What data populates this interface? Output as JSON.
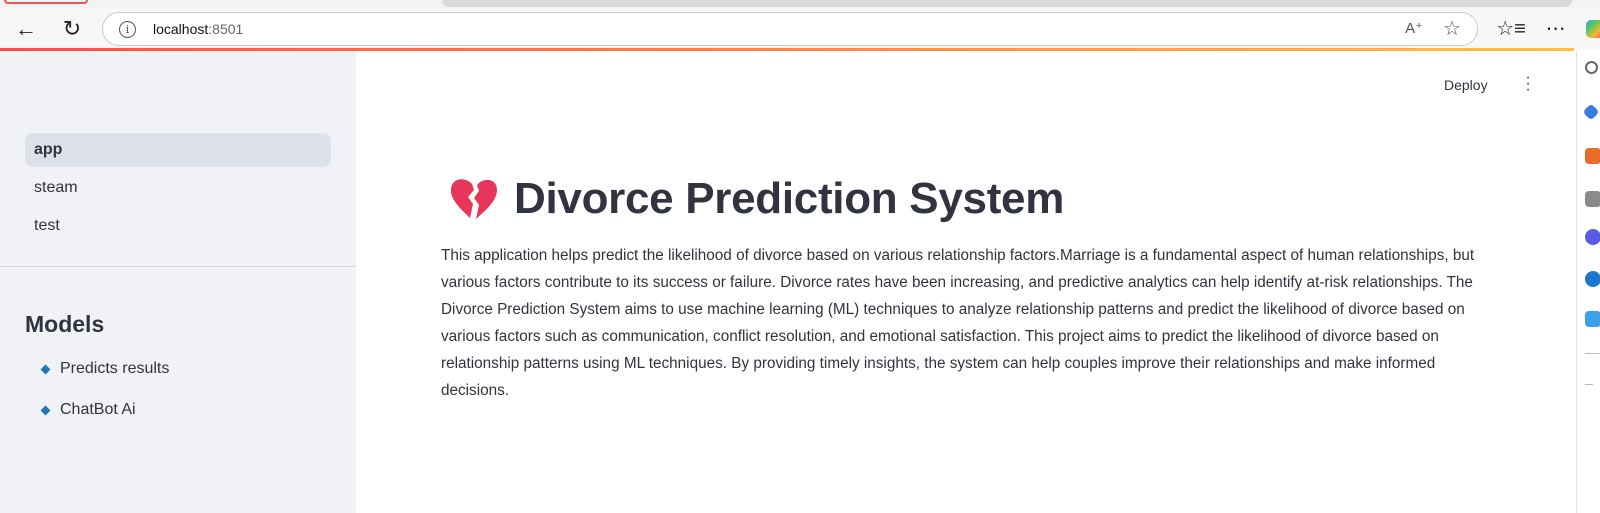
{
  "browser": {
    "url_host": "localhost",
    "url_port": ":8501"
  },
  "sidebar": {
    "pages": [
      {
        "label": "app",
        "active": true
      },
      {
        "label": "steam",
        "active": false
      },
      {
        "label": "test",
        "active": false
      }
    ],
    "models_heading": "Models",
    "models": [
      {
        "label": "Predicts results"
      },
      {
        "label": "ChatBot Ai"
      }
    ]
  },
  "header": {
    "deploy_label": "Deploy"
  },
  "main": {
    "title": "Divorce Prediction System",
    "title_icon": "broken-heart-icon",
    "description": "This application helps predict the likelihood of divorce based on various relationship factors.Marriage is a fundamental aspect of human relationships, but various factors contribute to its success or failure. Divorce rates have been increasing, and predictive analytics can help identify at-risk relationships. The Divorce Prediction System aims to use machine learning (ML) techniques to analyze relationship patterns and predict the likelihood of divorce based on various factors such as communication, conflict resolution, and emotional satisfaction. This project aims to predict the likelihood of divorce based on relationship patterns using ML techniques. By providing timely insights, the system can help couples improve their relationships and make informed decisions."
  },
  "colors": {
    "accent": "#ff4b4b",
    "heart": "#e8365a",
    "sidebar_bg": "#f0f2f6",
    "bullet": "#1f77b4"
  }
}
